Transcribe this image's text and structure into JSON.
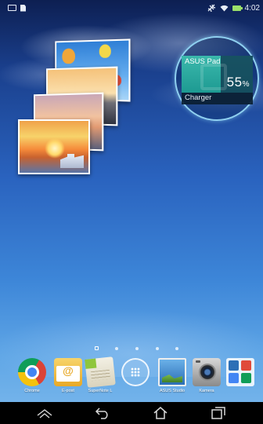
{
  "status_bar": {
    "left_icons": [
      "image-notification-icon",
      "document-notification-icon"
    ],
    "right_icons": [
      "airplane-off-icon",
      "wifi-icon",
      "battery-icon"
    ],
    "time": "4:02"
  },
  "wallpaper": {
    "theme": "blue-sky-clouds"
  },
  "photo_widget": {
    "photos": [
      "hot-air-balloons",
      "sunset-sea",
      "evening-lake",
      "sunset-santorini"
    ]
  },
  "battery_widget": {
    "device_name": "ASUS Pad",
    "percent": "55",
    "percent_sign": "%",
    "charge_level": 0.55,
    "charger_label": "Charger",
    "accent_color": "#1d9a92"
  },
  "home_pages": {
    "count": 5,
    "current": 0
  },
  "dock": {
    "apps": [
      {
        "label": "Chrome",
        "icon": "chrome-icon"
      },
      {
        "label": "E-post",
        "icon": "email-icon"
      },
      {
        "label": "SuperNote L",
        "icon": "supernote-icon"
      },
      {
        "label": "",
        "icon": "app-drawer-icon"
      },
      {
        "label": "ASUS Studio",
        "icon": "asus-studio-icon"
      },
      {
        "label": "Kamera",
        "icon": "camera-icon"
      },
      {
        "label": "",
        "icon": "app-folder-icon"
      }
    ]
  },
  "nav_bar": {
    "buttons": [
      "recent-apps-up-icon",
      "back-icon",
      "home-icon",
      "recents-icon"
    ]
  }
}
